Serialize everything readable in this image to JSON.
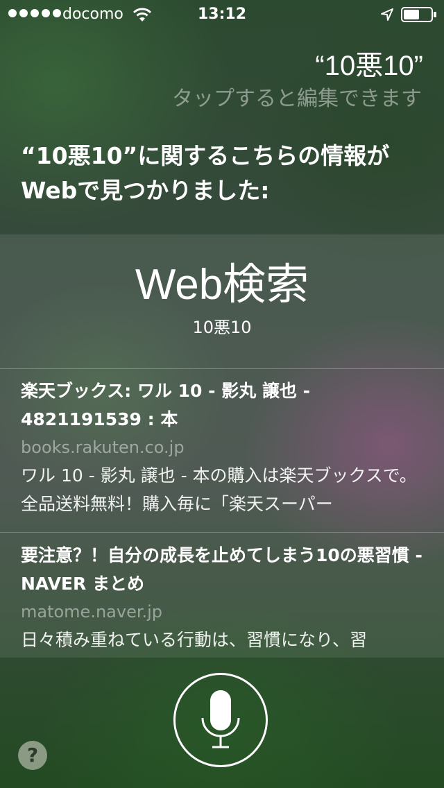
{
  "status_bar": {
    "carrier": "docomo",
    "time": "13:12",
    "icons": [
      "signal-dots-icon",
      "wifi-icon",
      "location-arrow-icon",
      "battery-icon"
    ]
  },
  "query": {
    "text": "“10悪10”",
    "hint": "タップすると編集できます"
  },
  "siri_response": "“10悪10”に関するこちらの情報がWebで見つかりました:",
  "web_search": {
    "title": "Web検索",
    "query": "10悪10",
    "results": [
      {
        "title": "楽天ブックス: ワル 10 - 影丸 譲也 - 4821191539 : 本",
        "url": "books.rakuten.co.jp",
        "snippet": "ワル 10 - 影丸 譲也 - 本の購入は楽天ブックスで。全品送料無料！購入毎に「楽天スーパー"
      },
      {
        "title": "要注意？！自分の成長を止めてしまう10の悪習慣 - NAVER まとめ",
        "url": "matome.naver.jp",
        "snippet": "日々積み重ねている行動は、習慣になり、習"
      }
    ]
  },
  "controls": {
    "mic_icon": "microphone-icon",
    "help_label": "?"
  },
  "colors": {
    "text": "#ffffff",
    "muted_text": "rgba(255,255,255,0.45)"
  }
}
